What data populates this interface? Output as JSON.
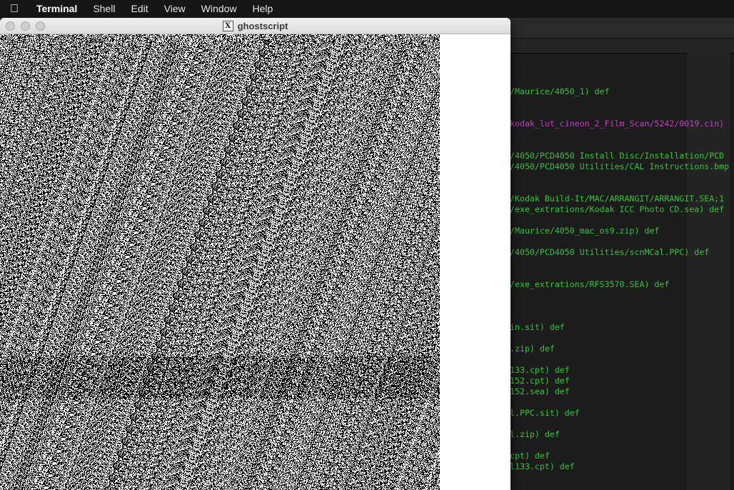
{
  "menubar": {
    "apple_icon": "",
    "app_name": "Terminal",
    "items": [
      "Shell",
      "Edit",
      "View",
      "Window",
      "Help"
    ]
  },
  "gs_window": {
    "title": "ghostscript",
    "icon": "x11-icon",
    "icon_glyph": "X"
  },
  "terminal": {
    "lines": [
      {
        "text": "/Maurice/4050_1) def",
        "color": "green"
      },
      {
        "text": "kodak_lut_cineon_2_Film_Scan/5242/0019.cin)",
        "color": "magenta"
      },
      {
        "text": "/4050/PCD4050 Install Disc/Installation/PCD",
        "color": "green"
      },
      {
        "text": "/4050/PCD4050 Utilities/CAL Instructions.bmp",
        "color": "green"
      },
      {
        "text": "/Kodak Build-It/MAC/ARRANGIT/ARRANGIT.SEA;1",
        "color": "green"
      },
      {
        "text": "/exe_extrations/Kodak ICC Photo CD.sea) def",
        "color": "green"
      },
      {
        "text": "/Maurice/4050_mac_os9.zip) def",
        "color": "green"
      },
      {
        "text": "/4050/PCD4050 Utilities/scnMCal.PPC) def",
        "color": "green"
      },
      {
        "text": "/exe_extrations/RFS3570.SEA) def",
        "color": "green"
      },
      {
        "text": "in.sit) def",
        "color": "green"
      },
      {
        "text": ".zip) def",
        "color": "green"
      },
      {
        "text": "133.cpt) def",
        "color": "green"
      },
      {
        "text": "152.cpt) def",
        "color": "green"
      },
      {
        "text": "152.sea) def",
        "color": "green"
      },
      {
        "text": "l.PPC.sit) def",
        "color": "green"
      },
      {
        "text": "l.zip) def",
        "color": "green"
      },
      {
        "text": "cpt) def",
        "color": "green"
      },
      {
        "text": "l133.cpt) def",
        "color": "green"
      }
    ]
  }
}
